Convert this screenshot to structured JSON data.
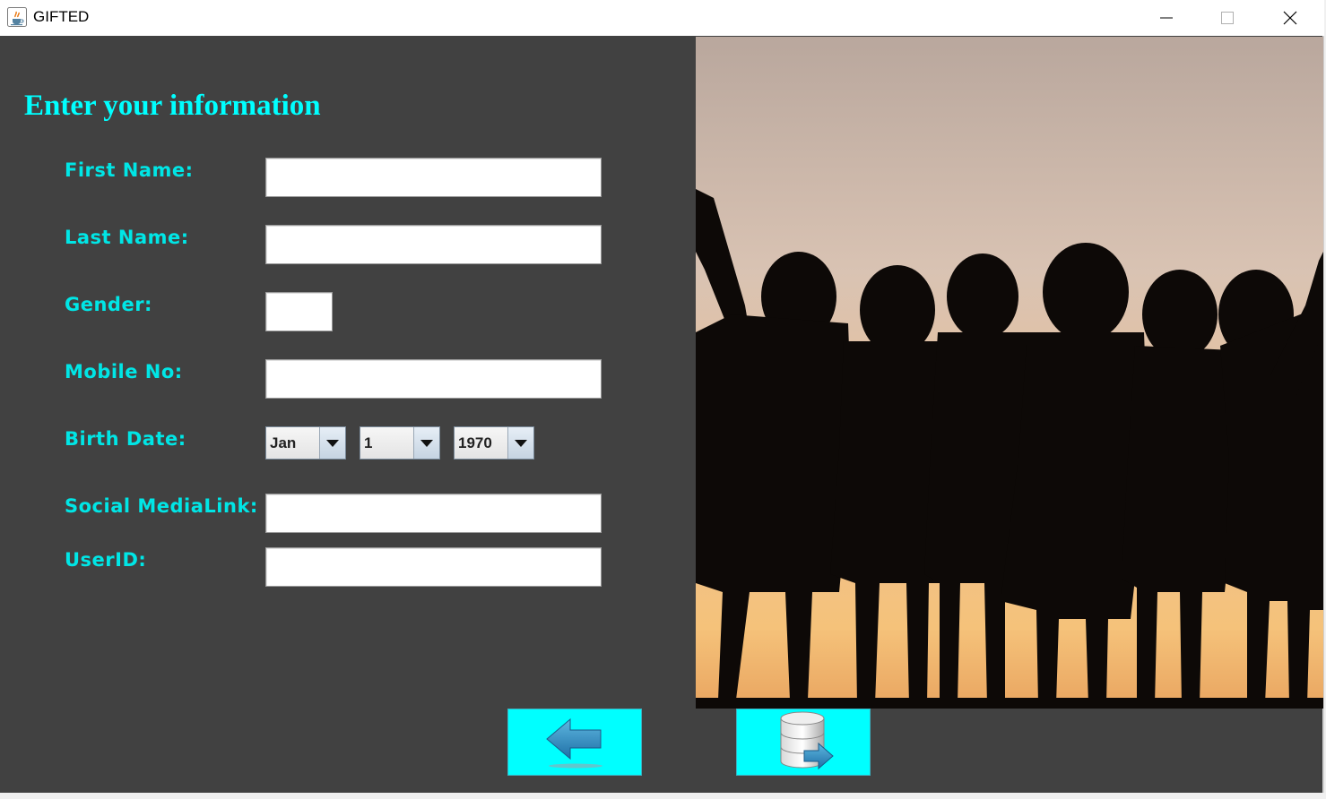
{
  "window": {
    "title": "GIFTED"
  },
  "form": {
    "heading": "Enter your information",
    "labels": {
      "first_name": "First Name:",
      "last_name": "Last Name:",
      "gender": "Gender:",
      "mobile": "Mobile No:",
      "birth_date": "Birth Date:",
      "social_media": "Social MediaLink:",
      "user_id": "UserID:"
    },
    "values": {
      "first_name": "",
      "last_name": "",
      "gender": "",
      "mobile": "",
      "social_media": "",
      "user_id": ""
    },
    "birth_date": {
      "month": "Jan",
      "day": "1",
      "year": "1970"
    }
  },
  "icons": {
    "app": "java-cup-icon",
    "back": "left-arrow-icon",
    "save": "database-export-icon"
  },
  "colors": {
    "panel_bg": "#414141",
    "accent_text": "#00ffff",
    "button_bg": "#00ffff"
  }
}
